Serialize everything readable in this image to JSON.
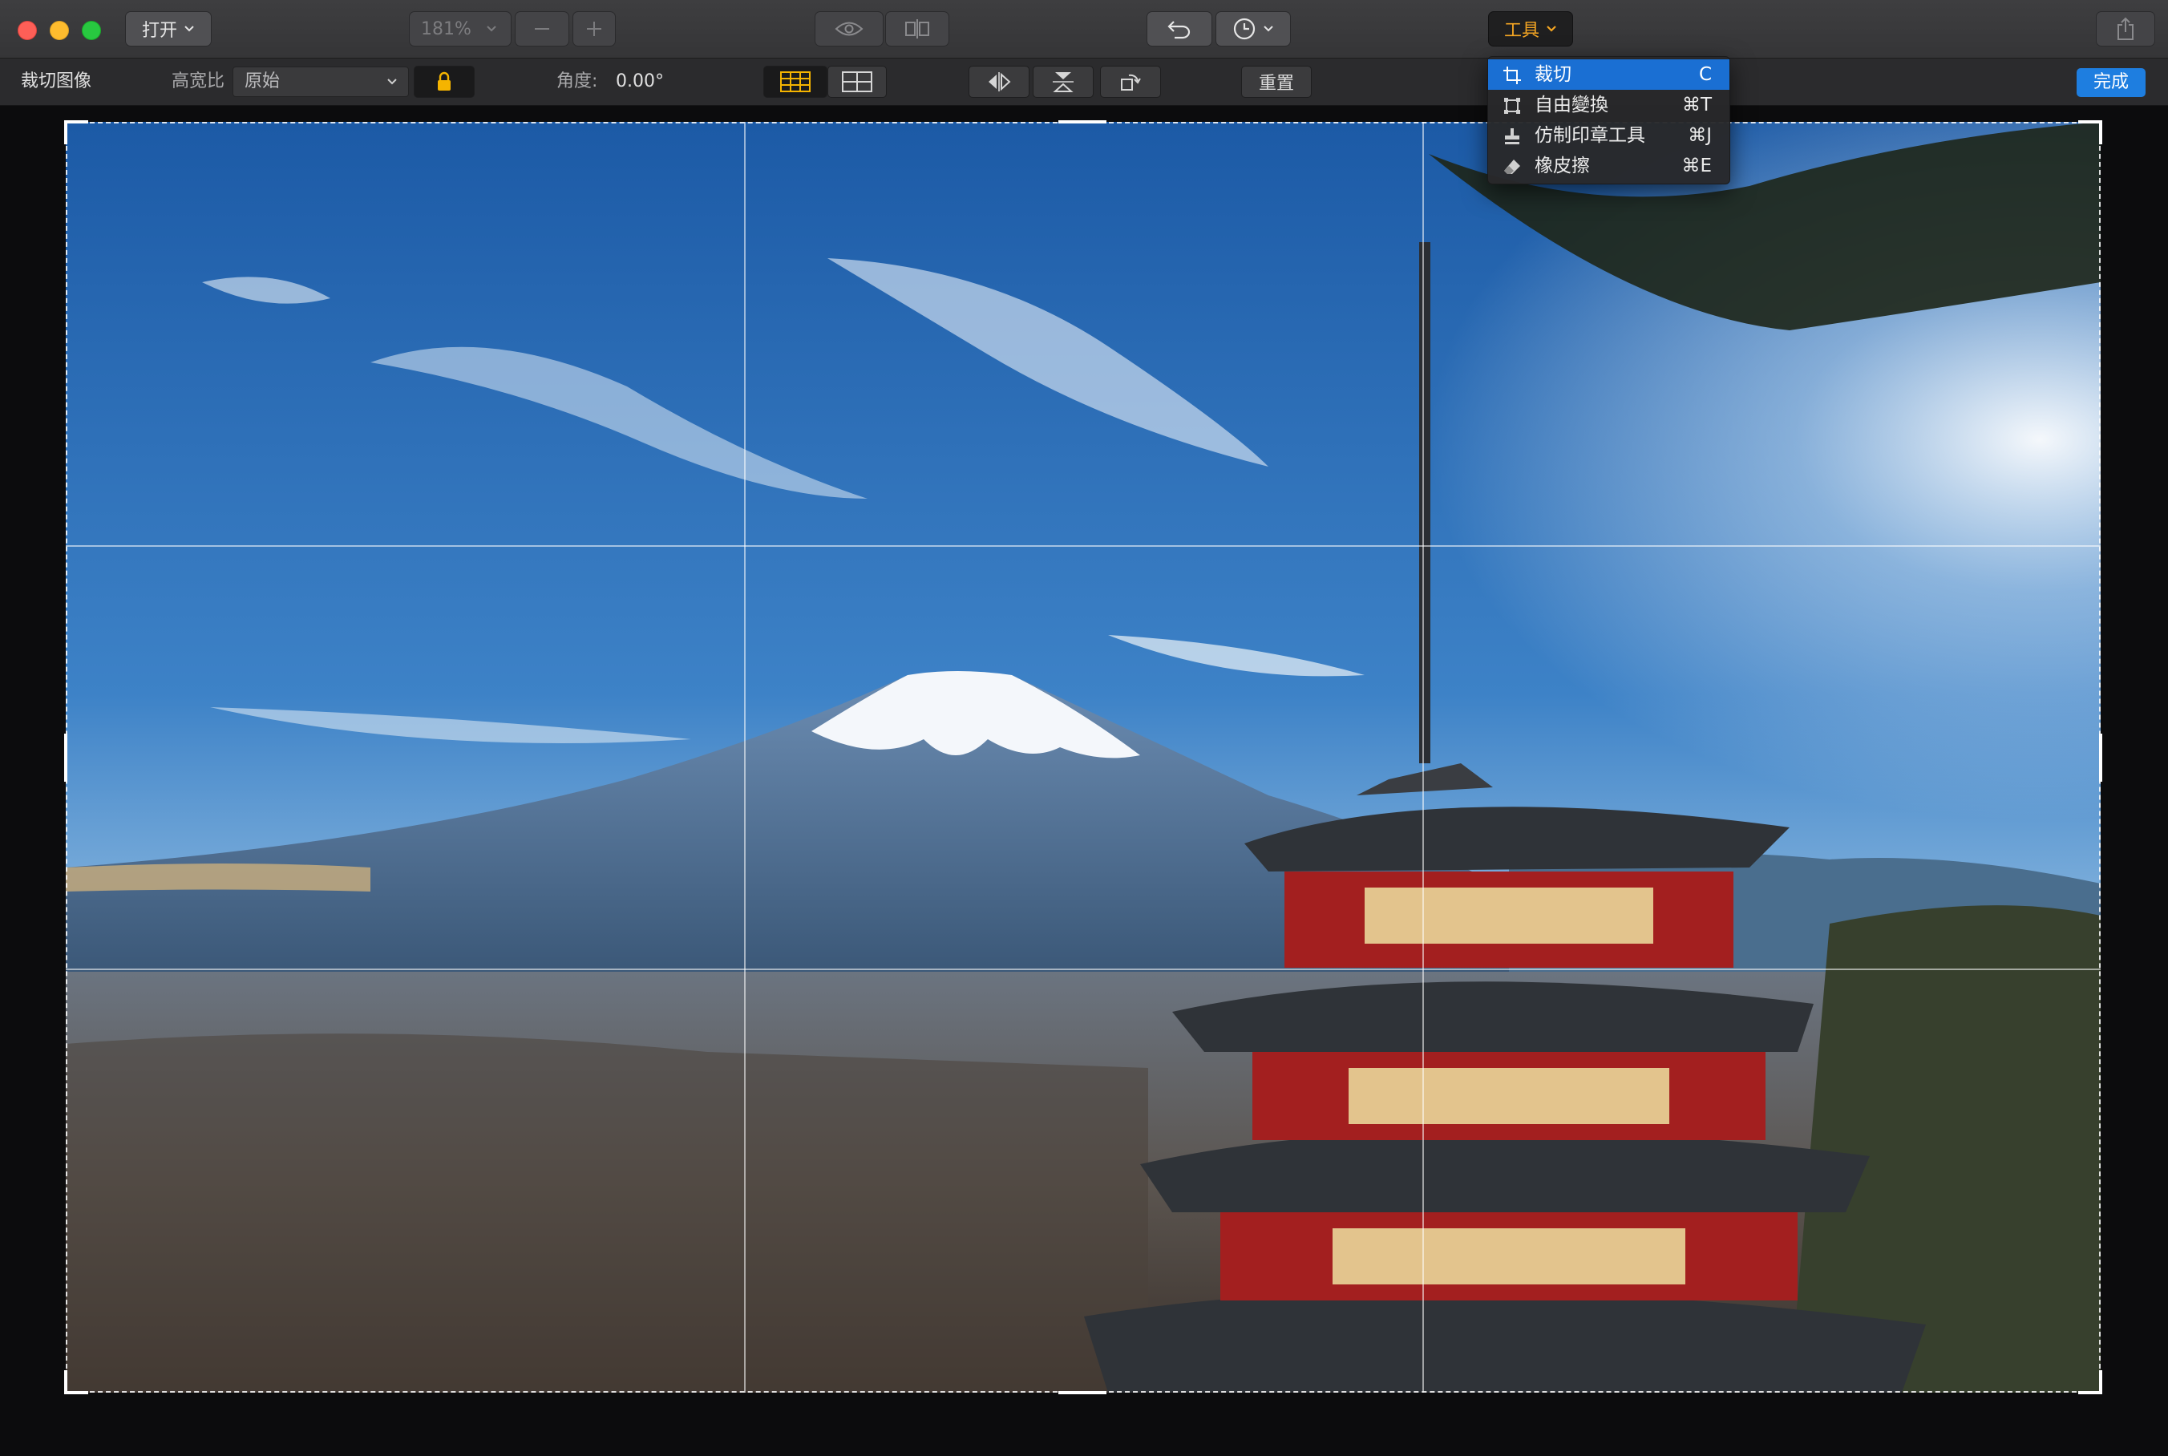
{
  "titlebar": {
    "open_label": "打开",
    "zoom_label": "181%",
    "tools_label": "工具"
  },
  "toolbar": {
    "title": "裁切图像",
    "aspect_label": "高宽比",
    "aspect_value": "原始",
    "angle_label": "角度:",
    "angle_value": "0.00°",
    "reset_label": "重置",
    "done_label": "完成"
  },
  "tools_menu": {
    "items": [
      {
        "label": "裁切",
        "shortcut": "C",
        "icon": "crop-icon",
        "active": true
      },
      {
        "label": "自由變換",
        "shortcut": "⌘T",
        "icon": "transform-icon",
        "active": false
      },
      {
        "label": "仿制印章工具",
        "shortcut": "⌘J",
        "icon": "stamp-icon",
        "active": false
      },
      {
        "label": "橡皮擦",
        "shortcut": "⌘E",
        "icon": "eraser-icon",
        "active": false
      }
    ]
  },
  "colors": {
    "accent": "#1e7ee0",
    "menu_highlight": "#1a6fd3",
    "tools_label": "#f5a623",
    "lock": "#f5b400"
  }
}
